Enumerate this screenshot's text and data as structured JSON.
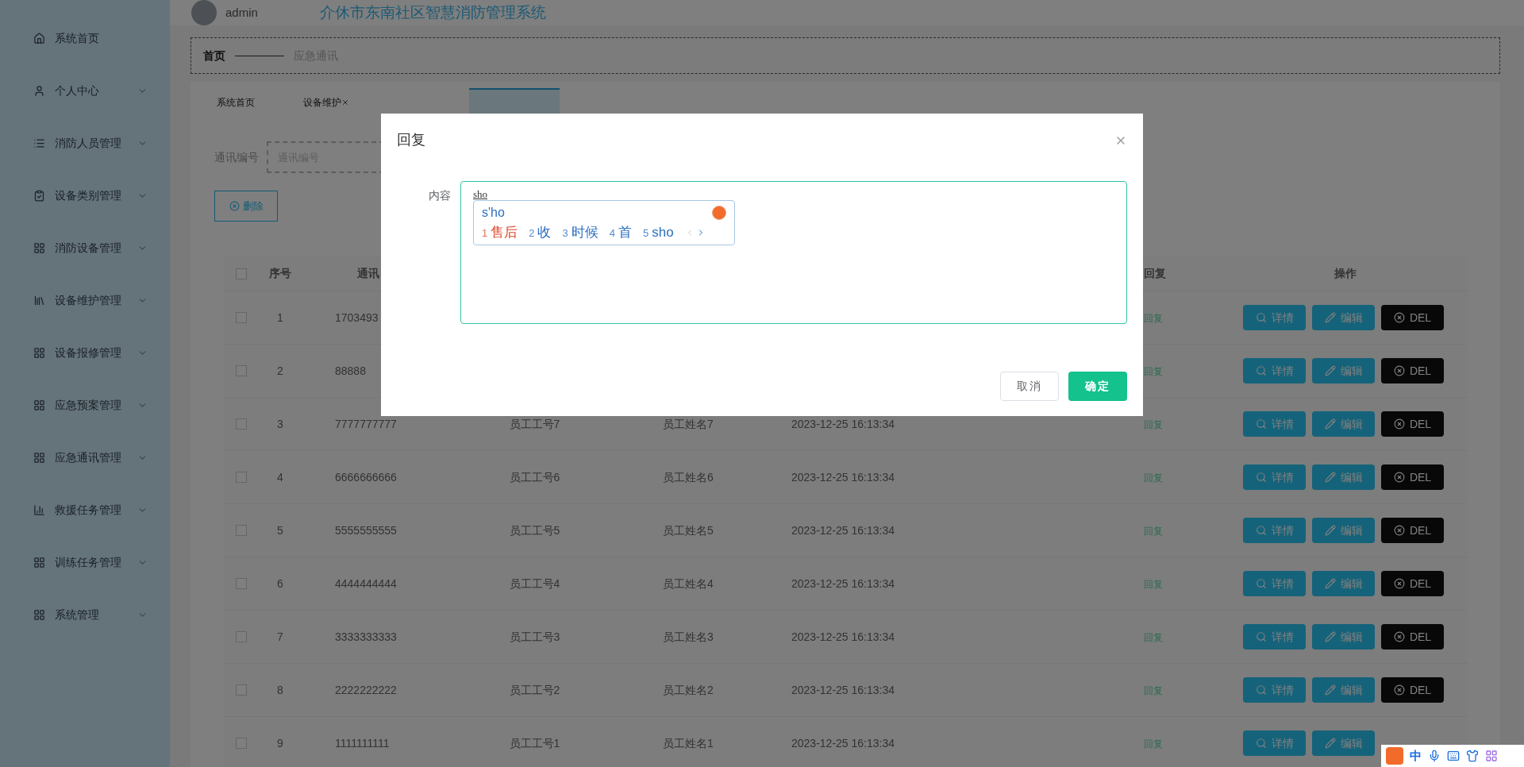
{
  "sidebar": {
    "items": [
      {
        "label": "系统首页",
        "expandable": false
      },
      {
        "label": "个人中心",
        "expandable": true
      },
      {
        "label": "消防人员管理",
        "expandable": true
      },
      {
        "label": "设备类别管理",
        "expandable": true
      },
      {
        "label": "消防设备管理",
        "expandable": true
      },
      {
        "label": "设备维护管理",
        "expandable": true
      },
      {
        "label": "设备报修管理",
        "expandable": true
      },
      {
        "label": "应急预案管理",
        "expandable": true
      },
      {
        "label": "应急通讯管理",
        "expandable": true
      },
      {
        "label": "救援任务管理",
        "expandable": true
      },
      {
        "label": "训练任务管理",
        "expandable": true
      },
      {
        "label": "系统管理",
        "expandable": true
      }
    ]
  },
  "header": {
    "user": "admin",
    "title": "介休市东南社区智慧消防管理系统"
  },
  "breadcrumb": [
    {
      "label": "首页",
      "current": false
    },
    {
      "label": "应急通讯",
      "current": true
    }
  ],
  "tabs": [
    {
      "label": "系统首页",
      "selected": false,
      "closable": false
    },
    {
      "label": "设备维护",
      "selected": false,
      "closable": true
    },
    {
      "selected": true,
      "closable": false
    }
  ],
  "search": {
    "label": "通讯编号",
    "placeholder": "通讯编号"
  },
  "delete_button": "删除",
  "table": {
    "select_all": {
      "checked": false
    },
    "columns": {
      "index": "序号",
      "column_2": "通讯",
      "reply": "回复",
      "actions": "操作"
    },
    "rows": [
      {
        "checked": false,
        "index": "1",
        "number": "1703493",
        "reply": "回复",
        "actions": [
          "详情",
          "编辑",
          "DEL"
        ]
      },
      {
        "checked": false,
        "index": "2",
        "number": "88888",
        "reply": "回复",
        "actions": [
          "详情",
          "编辑",
          "DEL"
        ]
      },
      {
        "checked": false,
        "index": "3",
        "number": "7777777777",
        "employee_id": "员工工号7",
        "employee_name": "员工姓名7",
        "time": "2023-12-25 16:13:34",
        "reply": "回复",
        "actions": [
          "详情",
          "编辑",
          "DEL"
        ]
      },
      {
        "checked": false,
        "index": "4",
        "number": "6666666666",
        "employee_id": "员工工号6",
        "employee_name": "员工姓名6",
        "time": "2023-12-25 16:13:34",
        "reply": "回复",
        "actions": [
          "详情",
          "编辑",
          "DEL"
        ]
      },
      {
        "checked": false,
        "index": "5",
        "number": "5555555555",
        "employee_id": "员工工号5",
        "employee_name": "员工姓名5",
        "time": "2023-12-25 16:13:34",
        "reply": "回复",
        "actions": [
          "详情",
          "编辑",
          "DEL"
        ]
      },
      {
        "checked": false,
        "index": "6",
        "number": "4444444444",
        "employee_id": "员工工号4",
        "employee_name": "员工姓名4",
        "time": "2023-12-25 16:13:34",
        "reply": "回复",
        "actions": [
          "详情",
          "编辑",
          "DEL"
        ]
      },
      {
        "checked": false,
        "index": "7",
        "number": "3333333333",
        "employee_id": "员工工号3",
        "employee_name": "员工姓名3",
        "time": "2023-12-25 16:13:34",
        "reply": "回复",
        "actions": [
          "详情",
          "编辑",
          "DEL"
        ]
      },
      {
        "checked": false,
        "index": "8",
        "number": "2222222222",
        "employee_id": "员工工号2",
        "employee_name": "员工姓名2",
        "time": "2023-12-25 16:13:34",
        "reply": "回复",
        "actions": [
          "详情",
          "编辑",
          "DEL"
        ]
      },
      {
        "checked": false,
        "index": "9",
        "number": "1111111111",
        "employee_id": "员工工号1",
        "employee_name": "员工姓名1",
        "time": "2023-12-25 16:13:34",
        "reply": "回复",
        "actions": [
          "详情",
          "编辑"
        ]
      }
    ]
  },
  "dialog": {
    "title": "回复",
    "field_label": "内容",
    "value": "sho",
    "ime": {
      "composition": "s'ho",
      "candidates": [
        {
          "number": "1",
          "text": "售后",
          "selected": true
        },
        {
          "number": "2",
          "text": "收",
          "selected": false
        },
        {
          "number": "3",
          "text": "时候",
          "selected": false
        },
        {
          "number": "4",
          "text": "首",
          "selected": false
        },
        {
          "number": "5",
          "text": "sho",
          "selected": false
        }
      ]
    },
    "buttons": [
      {
        "label": "取消",
        "kind": "secondary"
      },
      {
        "label": "确定",
        "kind": "primary"
      }
    ]
  },
  "ime_toolbar": {
    "mode": "中"
  }
}
